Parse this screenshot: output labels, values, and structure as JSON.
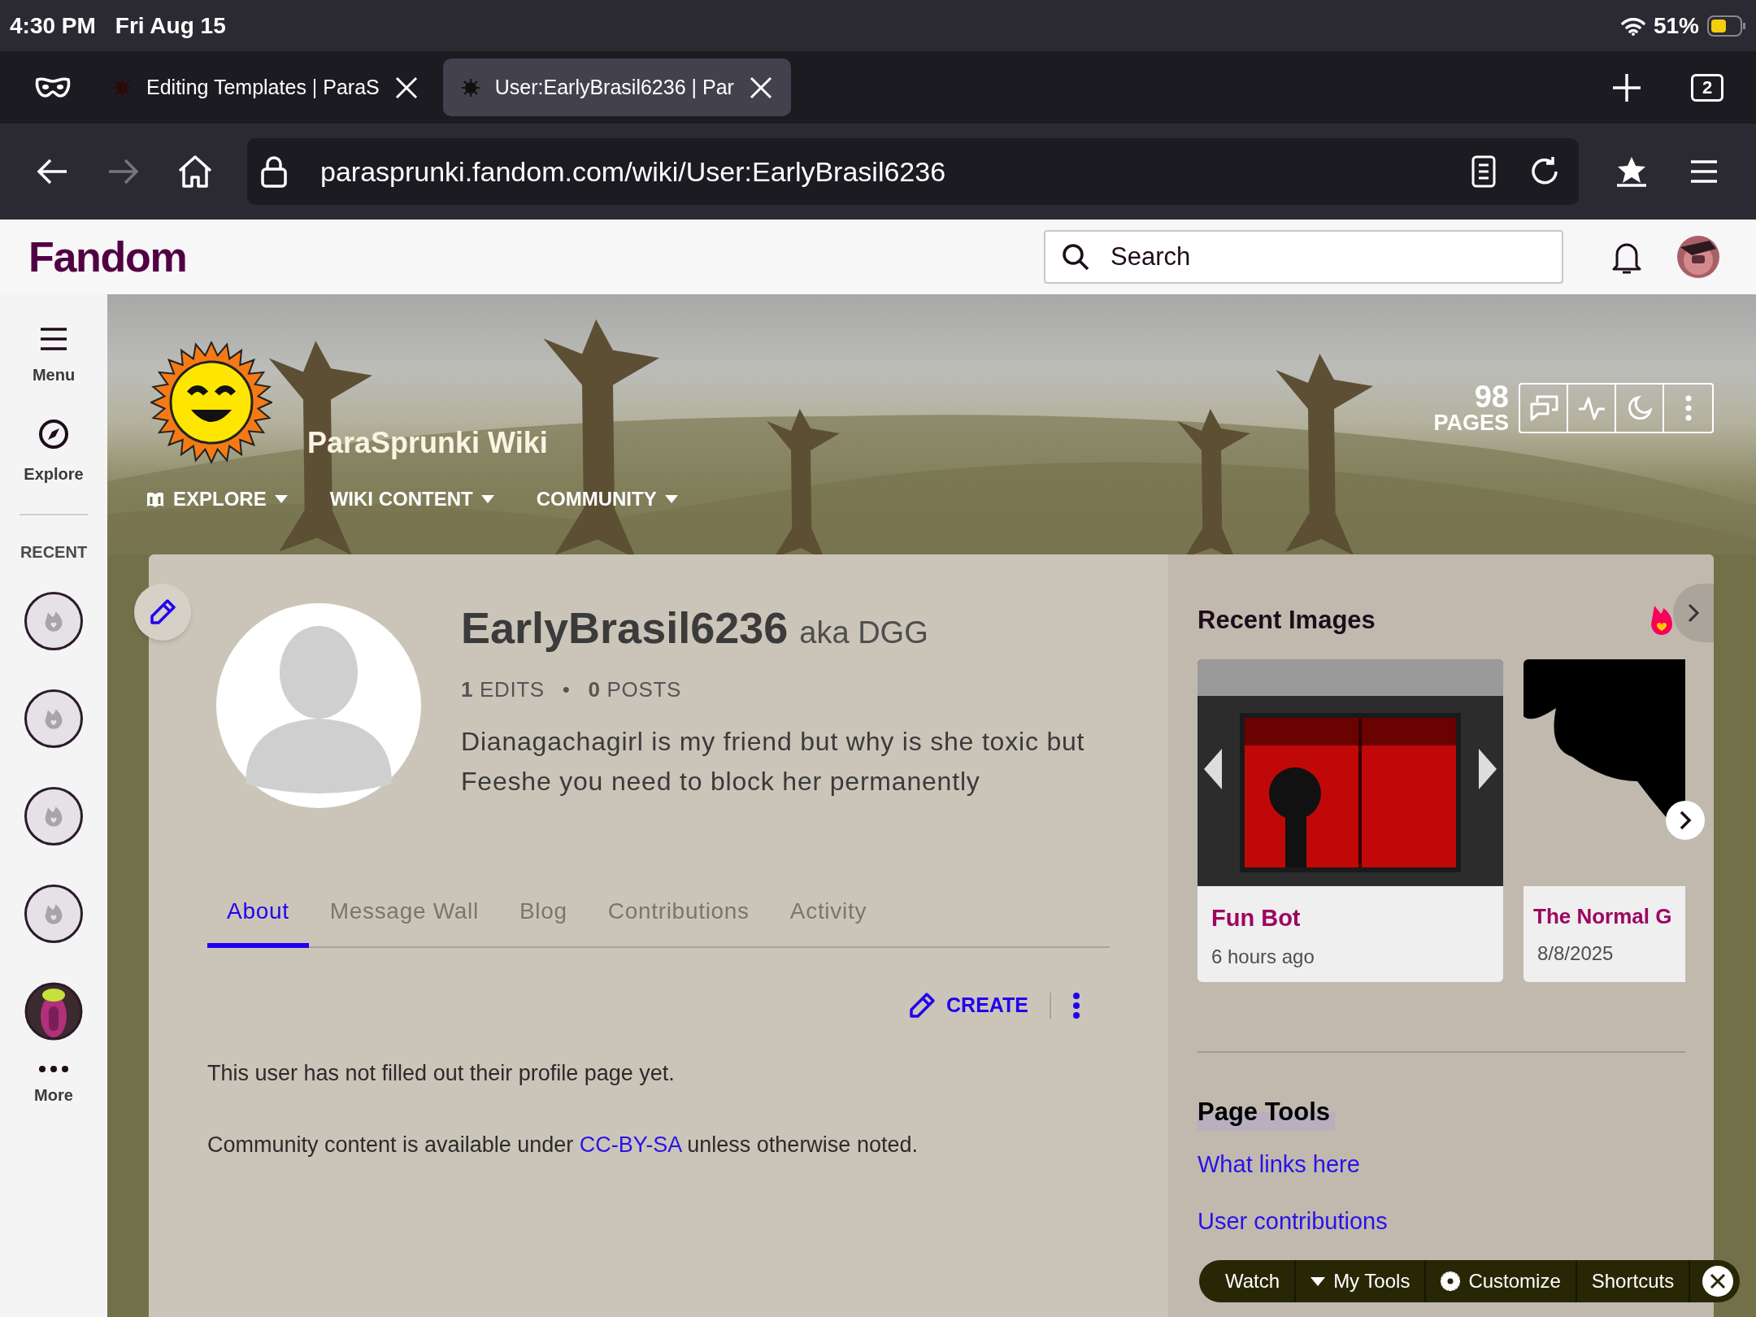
{
  "status_bar": {
    "time": "4:30 PM",
    "date": "Fri Aug 15",
    "battery": "51%"
  },
  "browser": {
    "tabs": [
      {
        "title": "Editing Templates | ParaS",
        "selected": false
      },
      {
        "title": "User:EarlyBrasil6236 | Par",
        "selected": true
      }
    ],
    "tab_count": "2",
    "forward_disabled": true,
    "url": "parasprunki.fandom.com/wiki/User:EarlyBrasil6236"
  },
  "fandom_bar": {
    "logo": "Fandom",
    "search": {
      "placeholder": "Search"
    }
  },
  "left_rail": {
    "items": [
      {
        "kind": "menu",
        "label": "Menu"
      },
      {
        "kind": "explore",
        "label": "Explore"
      }
    ],
    "recent_heading": "RECENT",
    "recent": [
      {
        "kind": "wiki"
      },
      {
        "kind": "wiki"
      },
      {
        "kind": "wiki"
      },
      {
        "kind": "wiki"
      },
      {
        "kind": "picture"
      }
    ],
    "more": "More"
  },
  "wiki": {
    "name": "ParaSprunki Wiki",
    "nav": [
      {
        "kind": "explore",
        "label": "EXPLORE"
      },
      {
        "kind": "plain",
        "label": "WIKI CONTENT"
      },
      {
        "kind": "plain",
        "label": "COMMUNITY"
      }
    ],
    "page_count": "98",
    "page_label": "PAGES"
  },
  "profile": {
    "name": "EarlyBrasil6236",
    "aka": "aka DGG",
    "stats": [
      {
        "count": "1",
        "label": "EDITS"
      },
      {
        "count": "0",
        "label": "POSTS"
      }
    ],
    "stat_separator": "•",
    "bio": "Dianagachagirl is my friend but why is she toxic but Feeshe you need to block her permanently",
    "tabs": [
      {
        "label": "About",
        "selected": true
      },
      {
        "label": "Message Wall",
        "selected": false
      },
      {
        "label": "Blog",
        "selected": false
      },
      {
        "label": "Contributions",
        "selected": false
      },
      {
        "label": "Activity",
        "selected": false
      }
    ],
    "create": "CREATE",
    "empty_note": "This user has not filled out their profile page yet.",
    "license": {
      "before": "Community content is available under ",
      "link": "CC-BY-SA",
      "after": " unless otherwise noted."
    }
  },
  "recent_images": {
    "heading": "Recent Images",
    "items": [
      {
        "title": "Fun Bot",
        "meta": "6 hours ago"
      },
      {
        "title": "The Normal G",
        "meta": "8/8/2025"
      }
    ]
  },
  "page_tools": {
    "heading": "Page Tools",
    "links": [
      "What links here",
      "User contributions"
    ]
  },
  "toolbar": [
    {
      "kind": "plain",
      "label": "Watch"
    },
    {
      "kind": "dropdown",
      "label": "My Tools"
    },
    {
      "kind": "gear",
      "label": "Customize"
    },
    {
      "kind": "plain",
      "label": "Shortcuts"
    }
  ]
}
